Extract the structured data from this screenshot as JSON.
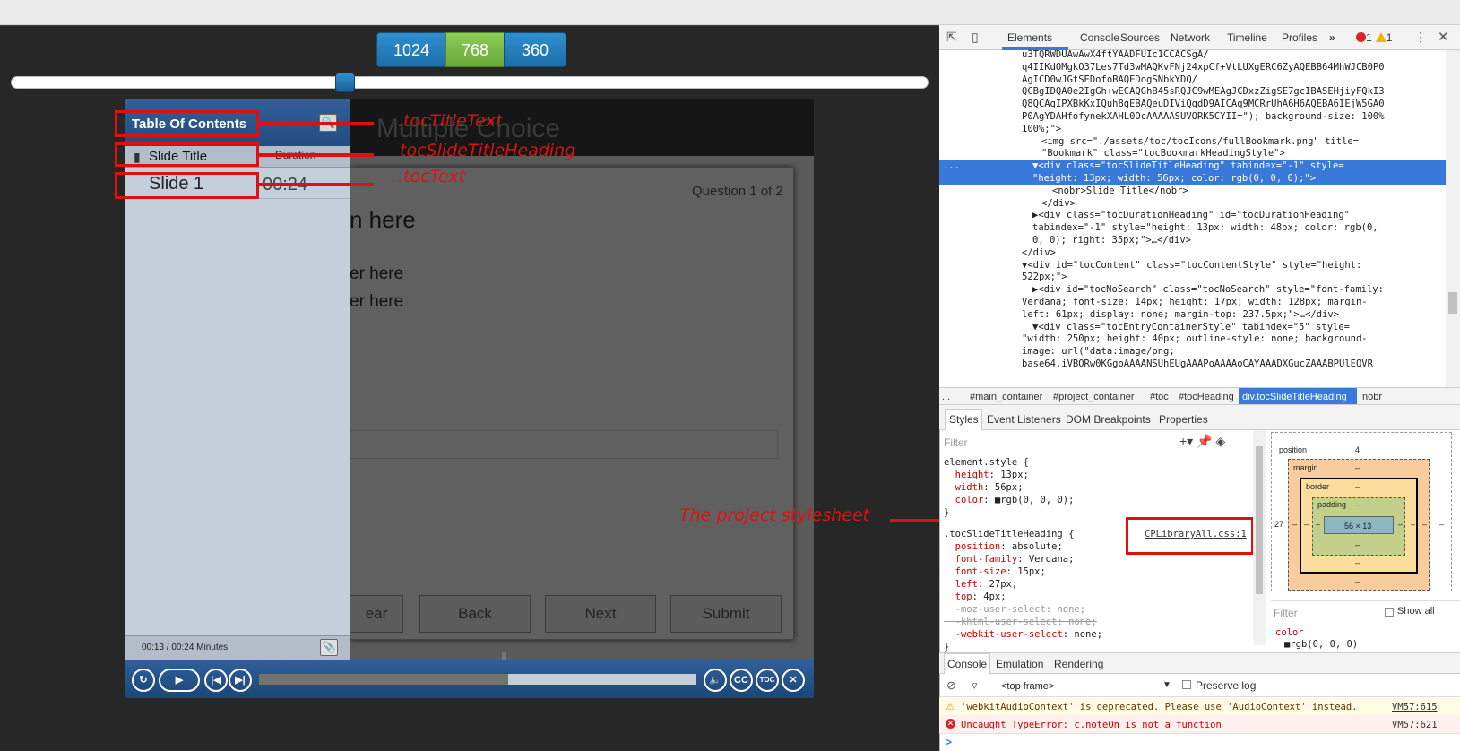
{
  "resolution_buttons": [
    "1024",
    "768",
    "360"
  ],
  "slide": {
    "title": "Multiple Choice",
    "question_count": "Question 1 of 2",
    "question_text": "n here",
    "answer1": "er here",
    "answer2": "er here",
    "buttons": {
      "clear": "ear",
      "back": "Back",
      "next": "Next",
      "submit": "Submit"
    }
  },
  "toc": {
    "title": "Table Of Contents",
    "slide_title_heading": "Slide Title",
    "duration_heading": "Duration",
    "entries": [
      {
        "title": "Slide 1",
        "duration": "00:24"
      }
    ],
    "time": "00:13 / 00:24 Minutes"
  },
  "playbar": {
    "progress": 0.57
  },
  "annotations": {
    "toc_title": ".tocTitleText",
    "slide_heading": "tocSlideTitleHeading",
    "toc_text": ".tocText",
    "stylesheet": "The project stylesheet"
  },
  "devtools": {
    "tabs": [
      "Elements",
      "Console",
      "Sources",
      "Network",
      "Timeline",
      "Profiles"
    ],
    "errors": "1",
    "warnings": "1",
    "dom_lines": [
      "u3TQRWDUAwAwX4ftYAADFUIc1CCACSgA/",
      "q4IIKdOMgkO37Les7Td3wMAQKvFNj24xpCf+VtLUXgERC6ZyAQEBB64MhWJCB0P0",
      "AgICD0wJGtSEDofoBAQEDogSNbkYDQ/",
      "QCBgIDQA0e2IgGh+wECAQGhB45sRQJC9wMEAgJCDxzZigSE7gcIBASEHjiyFQkI3",
      "Q8QCAgIPXBkKxIQuh8gEBAQeuDIViQgdD9AICAg9MCRrUhA6H6AQEBA6IEjW5GA0",
      "P0AgYDAHfofynekXAHL0OcAAAAASUVORK5CYII=\"); background-size: 100%",
      "100%;\">",
      "<img src=\"./assets/toc/tocIcons/fullBookmark.png\" title=",
      "\"Bookmark\" class=\"tocBookmarkHeadingStyle\">",
      "▼<div class=\"tocSlideTitleHeading\" tabindex=\"-1\" style=",
      "\"height: 13px; width: 56px; color: rgb(0, 0, 0);\">",
      "<nobr>Slide Title</nobr>",
      "</div>",
      "▶<div class=\"tocDurationHeading\" id=\"tocDurationHeading\"",
      "tabindex=\"-1\" style=\"height: 13px; width: 48px; color: rgb(0,",
      "0, 0); right: 35px;\">…</div>",
      "</div>",
      "▼<div id=\"tocContent\" class=\"tocContentStyle\" style=\"height:",
      "522px;\">",
      "▶<div id=\"tocNoSearch\" class=\"tocNoSearch\" style=\"font-family:",
      "Verdana; font-size: 14px; height: 17px; width: 128px; margin-",
      "left: 61px; display: none; margin-top: 237.5px;\">…</div>",
      "▼<div class=\"tocEntryContainerStyle\" tabindex=\"5\" style=",
      "\"width: 250px; height: 40px; outline-style: none; background-",
      "image: url(\"data:image/png;",
      "base64,iVBORw0KGgoAAAANSUhEUgAAAPoAAAAoCAYAAADXGucZAAABPUlEQVR"
    ],
    "breadcrumbs": [
      "...",
      "#main_container",
      "#project_container",
      "#toc",
      "#tocHeading",
      "div.tocSlideTitleHeading",
      "nobr"
    ],
    "style_tabs": [
      "Styles",
      "Event Listeners",
      "DOM Breakpoints",
      "Properties"
    ],
    "filter_placeholder": "Filter",
    "css_lines": [
      "element.style {",
      "  height: 13px;",
      "  width: 56px;",
      "  color: ■rgb(0, 0, 0);",
      "}",
      ".tocSlideTitleHeading {",
      "  position: absolute;",
      "  font-family: Verdana;",
      "  font-size: 15px;",
      "  left: 27px;",
      "  top: 4px;",
      "  -moz-user-select: none;",
      "  -khtml-user-select: none;",
      "  -webkit-user-select: none;",
      "}"
    ],
    "css_source": "CPLibraryAll.css:1",
    "box_model": {
      "position_label": "position",
      "position_value": "4",
      "margin_label": "margin",
      "border_label": "border",
      "padding_label": "padding",
      "content": "56 × 13",
      "dash": "–",
      "left_value": "27"
    },
    "show_all": "Show all",
    "computed_prop": "color",
    "computed_value": "■rgb(0, 0, 0)",
    "console_tabs": [
      "Console",
      "Emulation",
      "Rendering"
    ],
    "frame": "<top frame>",
    "preserve_log": "Preserve log",
    "messages": [
      {
        "type": "warning",
        "text": "'webkitAudioContext' is deprecated. Please use 'AudioContext' instead.",
        "source": "VM57:615"
      },
      {
        "type": "error",
        "text": "Uncaught TypeError: c.noteOn is not a function",
        "source": "VM57:621"
      }
    ],
    "prompt": ">"
  }
}
